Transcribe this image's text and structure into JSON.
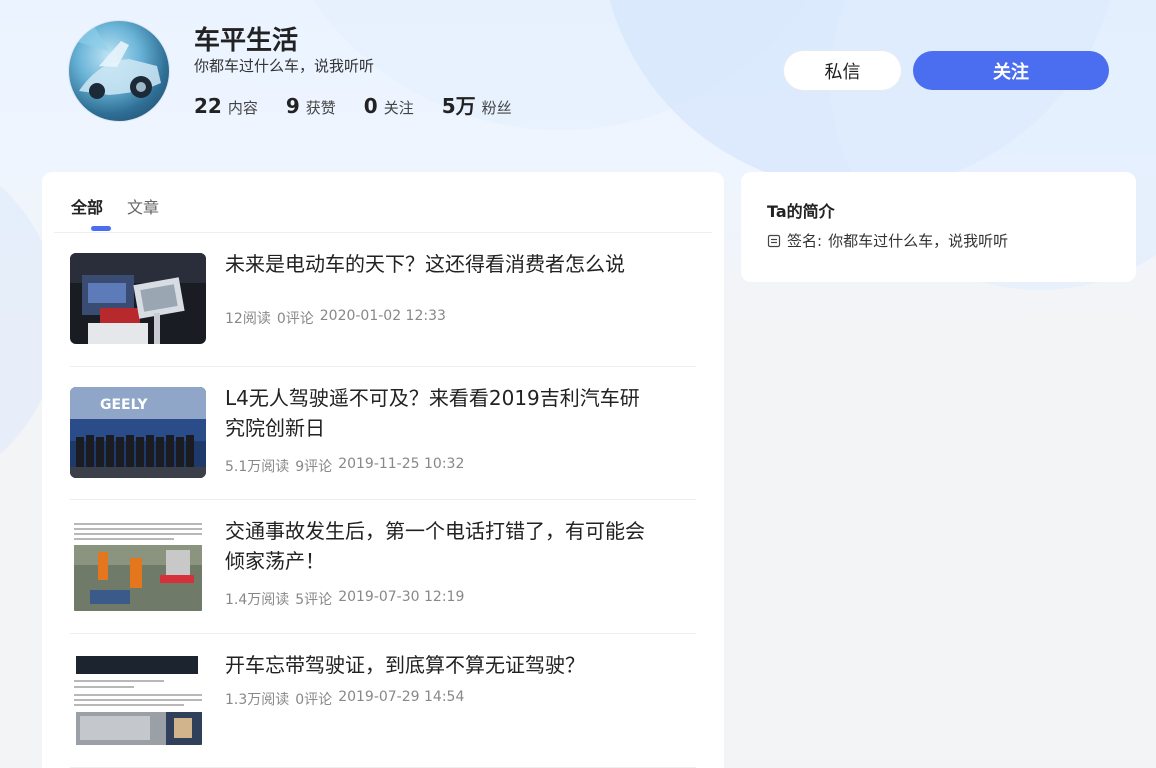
{
  "profile": {
    "name": "车平生活",
    "signature": "你都车过什么车，说我听听",
    "stats": [
      {
        "num": "22",
        "label": "内容"
      },
      {
        "num": "9",
        "label": "获赞"
      },
      {
        "num": "0",
        "label": "关注"
      },
      {
        "num": "5万",
        "label": "粉丝"
      }
    ]
  },
  "actions": {
    "message_label": "私信",
    "follow_label": "关注"
  },
  "tabs": [
    {
      "label": "全部",
      "active": true
    },
    {
      "label": "文章",
      "active": false
    }
  ],
  "articles": [
    {
      "title": "未来是电动车的天下？这还得看消费者怎么说",
      "reads": "12阅读",
      "comments": "0评论",
      "date": "2020-01-02 12:33",
      "thumb": "engine-display-image"
    },
    {
      "title": "L4无人驾驶遥不可及？来看看2019吉利汽车研究院创新日",
      "reads": "5.1万阅读",
      "comments": "9评论",
      "date": "2019-11-25 10:32",
      "thumb": "geely-group-photo-image",
      "thumb_text": "GEELY"
    },
    {
      "title": "交通事故发生后，第一个电话打错了，有可能会倾家荡产！",
      "reads": "1.4万阅读",
      "comments": "5评论",
      "date": "2019-07-30 12:19",
      "thumb": "accident-rescue-image"
    },
    {
      "title": "开车忘带驾驶证，到底算不算无证驾驶？",
      "reads": "1.3万阅读",
      "comments": "0评论",
      "date": "2019-07-29 14:54",
      "thumb": "driver-license-image"
    }
  ],
  "sidebar": {
    "title": "Ta的简介",
    "sign_label": "签名:",
    "sign_value": "你都车过什么车，说我听听"
  },
  "colors": {
    "accent": "#4b6ef0",
    "background": "#f3f4f6"
  }
}
